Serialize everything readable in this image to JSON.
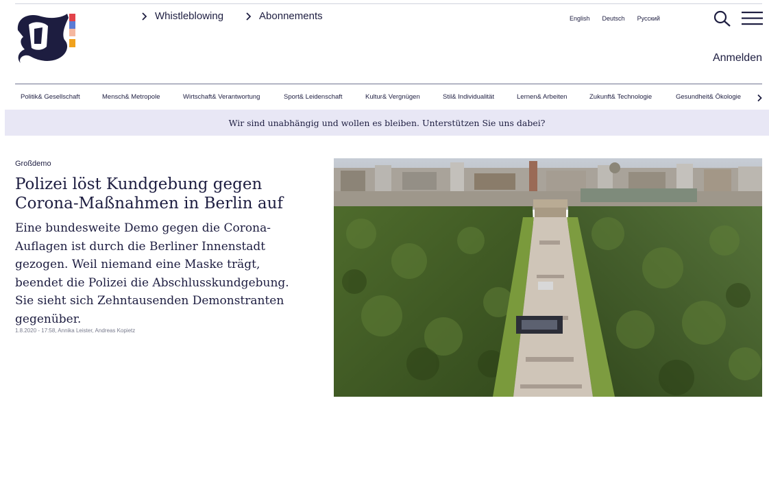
{
  "logo": {
    "name": "berliner-zeitung-logo"
  },
  "top_links": [
    {
      "label": "Whistleblowing"
    },
    {
      "label": "Abonnements"
    }
  ],
  "languages": [
    "English",
    "Deutsch",
    "Русский"
  ],
  "login_label": "Anmelden",
  "categories": [
    "Politik& Gesellschaft",
    "Mensch& Metropole",
    "Wirtschaft& Verantwortung",
    "Sport& Leidenschaft",
    "Kultur& Vergnügen",
    "Stil& Individualität",
    "Lernen& Arbeiten",
    "Zukunft& Technologie",
    "Gesundheit& Ökologie"
  ],
  "banner_text": "Wir sind unabhängig und wollen es bleiben. Unterstützen Sie uns dabei?",
  "article": {
    "kicker": "Großdemo",
    "headline": "Polizei löst Kundgebung gegen Corona-Maßnahmen in Berlin auf",
    "teaser": "Eine bundesweite Demo gegen die Corona-Auflagen ist durch die Berliner Innenstadt gezogen. Weil niemand eine Maske trägt, beendet die Polizei die Abschlusskundgebung. Sie sieht sich Zehntausenden Demonstranten gegenüber.",
    "date": "1.8.2020 - 17:58",
    "authors": "Annika Leister, Andreas Kopietz"
  },
  "colors": {
    "brand_navy": "#1d1d40",
    "logo_red": "#e2434a",
    "logo_blue": "#5a7bd5",
    "logo_peach": "#f5b8a0",
    "logo_orange": "#f0a21e",
    "banner_bg": "#e8e7f5"
  },
  "icons": {
    "search": "search-icon",
    "menu": "hamburger-menu-icon",
    "link_chevron": "chevron-right-icon",
    "nav_next": "chevron-right-icon"
  }
}
